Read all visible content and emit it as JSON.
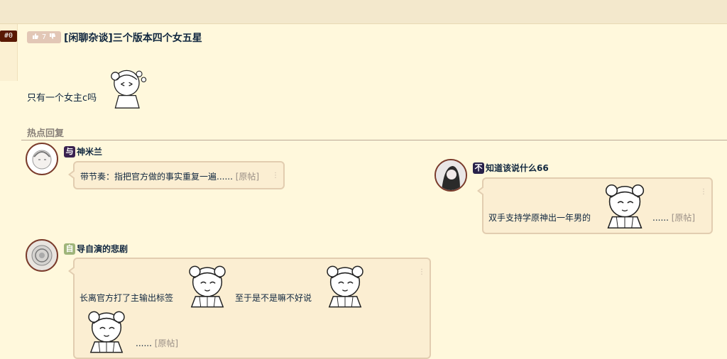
{
  "floor": "#0",
  "vote": {
    "count": "7"
  },
  "thread": {
    "title": "[闲聊杂谈]三个版本四个女五星",
    "body": "只有一个女主c吗"
  },
  "hot": {
    "title": "热点回复",
    "replies": [
      {
        "tag": "与",
        "tag_color": "#3a2250",
        "user": "神米兰",
        "text": "带节奏：指把官方做的事实重复一遍......",
        "more": "[原帖]"
      },
      {
        "tag": "不",
        "tag_color": "#28224a",
        "user": "知道该说什么66",
        "text": "双手支持学原神出一年男的",
        "ellipsis": "......",
        "more": "[原帖]"
      },
      {
        "tag": "自",
        "tag_color": "#9fb57a",
        "user": "导自演的悲剧",
        "text1": "长离官方打了主输出标签",
        "text2": "至于是不是嘛不好说",
        "ellipsis": "......",
        "more": "[原帖]"
      }
    ]
  },
  "icons": [
    "thumbs-up-icon",
    "thumbs-down-icon",
    "more-dots-icon"
  ],
  "colors": {
    "background": "#fff8dc",
    "topbar": "#f3e8cc",
    "floor_badge": "#591804",
    "bubble": "#fbeed2",
    "bubble_border": "#e2cdb0",
    "text": "#10273f"
  }
}
